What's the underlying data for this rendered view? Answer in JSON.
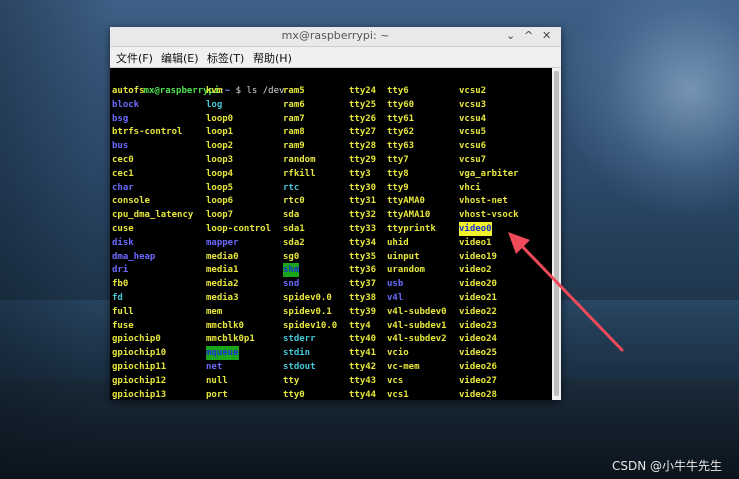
{
  "window": {
    "title": "mx@raspberrypi: ~",
    "minimize": "⌄",
    "maximize": "^",
    "close": "✕"
  },
  "menu": [
    {
      "label": "文件(F)"
    },
    {
      "label": "编辑(E)"
    },
    {
      "label": "标签(T)"
    },
    {
      "label": "帮助(H)"
    }
  ],
  "prompt": {
    "user": "mx@raspberrypi",
    "sep": ":",
    "path": "~",
    "cmd": " $ ls /dev"
  },
  "columns": [
    [
      {
        "t": "autofs",
        "c": "f"
      },
      {
        "t": "block",
        "c": "d"
      },
      {
        "t": "bsg",
        "c": "d"
      },
      {
        "t": "btrfs-control",
        "c": "f"
      },
      {
        "t": "bus",
        "c": "d"
      },
      {
        "t": "cec0",
        "c": "f"
      },
      {
        "t": "cec1",
        "c": "f"
      },
      {
        "t": "char",
        "c": "d"
      },
      {
        "t": "console",
        "c": "f"
      },
      {
        "t": "cpu_dma_latency",
        "c": "f"
      },
      {
        "t": "cuse",
        "c": "f"
      },
      {
        "t": "disk",
        "c": "d"
      },
      {
        "t": "dma_heap",
        "c": "d"
      },
      {
        "t": "dri",
        "c": "d"
      },
      {
        "t": "fb0",
        "c": "f"
      },
      {
        "t": "fd",
        "c": "l"
      },
      {
        "t": "full",
        "c": "f"
      },
      {
        "t": "fuse",
        "c": "f"
      },
      {
        "t": "gpiochip0",
        "c": "f"
      },
      {
        "t": "gpiochip10",
        "c": "f"
      },
      {
        "t": "gpiochip11",
        "c": "f"
      },
      {
        "t": "gpiochip12",
        "c": "f"
      },
      {
        "t": "gpiochip13",
        "c": "f"
      }
    ],
    [
      {
        "t": "kvm",
        "c": "f"
      },
      {
        "t": "log",
        "c": "l"
      },
      {
        "t": "loop0",
        "c": "f"
      },
      {
        "t": "loop1",
        "c": "f"
      },
      {
        "t": "loop2",
        "c": "f"
      },
      {
        "t": "loop3",
        "c": "f"
      },
      {
        "t": "loop4",
        "c": "f"
      },
      {
        "t": "loop5",
        "c": "f"
      },
      {
        "t": "loop6",
        "c": "f"
      },
      {
        "t": "loop7",
        "c": "f"
      },
      {
        "t": "loop-control",
        "c": "f"
      },
      {
        "t": "mapper",
        "c": "d"
      },
      {
        "t": "media0",
        "c": "f"
      },
      {
        "t": "media1",
        "c": "f"
      },
      {
        "t": "media2",
        "c": "f"
      },
      {
        "t": "media3",
        "c": "f"
      },
      {
        "t": "mem",
        "c": "f"
      },
      {
        "t": "mmcblk0",
        "c": "f"
      },
      {
        "t": "mmcblk0p1",
        "c": "f"
      },
      {
        "t": "mqueue",
        "c": "hl-green"
      },
      {
        "t": "net",
        "c": "d"
      },
      {
        "t": "null",
        "c": "f"
      },
      {
        "t": "port",
        "c": "f"
      }
    ],
    [
      {
        "t": "ram5",
        "c": "f"
      },
      {
        "t": "ram6",
        "c": "f"
      },
      {
        "t": "ram7",
        "c": "f"
      },
      {
        "t": "ram8",
        "c": "f"
      },
      {
        "t": "ram9",
        "c": "f"
      },
      {
        "t": "random",
        "c": "f"
      },
      {
        "t": "rfkill",
        "c": "f"
      },
      {
        "t": "rtc",
        "c": "l"
      },
      {
        "t": "rtc0",
        "c": "f"
      },
      {
        "t": "sda",
        "c": "f"
      },
      {
        "t": "sda1",
        "c": "f"
      },
      {
        "t": "sda2",
        "c": "f"
      },
      {
        "t": "sg0",
        "c": "f"
      },
      {
        "t": "shm",
        "c": "hl-green"
      },
      {
        "t": "snd",
        "c": "d"
      },
      {
        "t": "spidev0.0",
        "c": "f"
      },
      {
        "t": "spidev0.1",
        "c": "f"
      },
      {
        "t": "spidev10.0",
        "c": "f"
      },
      {
        "t": "stderr",
        "c": "l"
      },
      {
        "t": "stdin",
        "c": "l"
      },
      {
        "t": "stdout",
        "c": "l"
      },
      {
        "t": "tty",
        "c": "f"
      },
      {
        "t": "tty0",
        "c": "f"
      }
    ],
    [
      {
        "t": "tty24",
        "c": "f"
      },
      {
        "t": "tty25",
        "c": "f"
      },
      {
        "t": "tty26",
        "c": "f"
      },
      {
        "t": "tty27",
        "c": "f"
      },
      {
        "t": "tty28",
        "c": "f"
      },
      {
        "t": "tty29",
        "c": "f"
      },
      {
        "t": "tty3",
        "c": "f"
      },
      {
        "t": "tty30",
        "c": "f"
      },
      {
        "t": "tty31",
        "c": "f"
      },
      {
        "t": "tty32",
        "c": "f"
      },
      {
        "t": "tty33",
        "c": "f"
      },
      {
        "t": "tty34",
        "c": "f"
      },
      {
        "t": "tty35",
        "c": "f"
      },
      {
        "t": "tty36",
        "c": "f"
      },
      {
        "t": "tty37",
        "c": "f"
      },
      {
        "t": "tty38",
        "c": "f"
      },
      {
        "t": "tty39",
        "c": "f"
      },
      {
        "t": "tty4",
        "c": "f"
      },
      {
        "t": "tty40",
        "c": "f"
      },
      {
        "t": "tty41",
        "c": "f"
      },
      {
        "t": "tty42",
        "c": "f"
      },
      {
        "t": "tty43",
        "c": "f"
      },
      {
        "t": "tty44",
        "c": "f"
      }
    ],
    [
      {
        "t": "tty6",
        "c": "f"
      },
      {
        "t": "tty60",
        "c": "f"
      },
      {
        "t": "tty61",
        "c": "f"
      },
      {
        "t": "tty62",
        "c": "f"
      },
      {
        "t": "tty63",
        "c": "f"
      },
      {
        "t": "tty7",
        "c": "f"
      },
      {
        "t": "tty8",
        "c": "f"
      },
      {
        "t": "tty9",
        "c": "f"
      },
      {
        "t": "ttyAMA0",
        "c": "f"
      },
      {
        "t": "ttyAMA10",
        "c": "f"
      },
      {
        "t": "ttyprintk",
        "c": "f"
      },
      {
        "t": "uhid",
        "c": "f"
      },
      {
        "t": "uinput",
        "c": "f"
      },
      {
        "t": "urandom",
        "c": "f"
      },
      {
        "t": "usb",
        "c": "d"
      },
      {
        "t": "v4l",
        "c": "d"
      },
      {
        "t": "v4l-subdev0",
        "c": "f"
      },
      {
        "t": "v4l-subdev1",
        "c": "f"
      },
      {
        "t": "v4l-subdev2",
        "c": "f"
      },
      {
        "t": "vcio",
        "c": "f"
      },
      {
        "t": "vc-mem",
        "c": "f"
      },
      {
        "t": "vcs",
        "c": "f"
      },
      {
        "t": "vcs1",
        "c": "f"
      }
    ],
    [
      {
        "t": "vcsu2",
        "c": "f"
      },
      {
        "t": "vcsu3",
        "c": "f"
      },
      {
        "t": "vcsu4",
        "c": "f"
      },
      {
        "t": "vcsu5",
        "c": "f"
      },
      {
        "t": "vcsu6",
        "c": "f"
      },
      {
        "t": "vcsu7",
        "c": "f"
      },
      {
        "t": "vga_arbiter",
        "c": "f"
      },
      {
        "t": "vhci",
        "c": "f"
      },
      {
        "t": "vhost-net",
        "c": "f"
      },
      {
        "t": "vhost-vsock",
        "c": "f"
      },
      {
        "t": "video0",
        "c": "hl-yellow"
      },
      {
        "t": "video1",
        "c": "f"
      },
      {
        "t": "video19",
        "c": "f"
      },
      {
        "t": "video2",
        "c": "f"
      },
      {
        "t": "video20",
        "c": "f"
      },
      {
        "t": "video21",
        "c": "f"
      },
      {
        "t": "video22",
        "c": "f"
      },
      {
        "t": "video23",
        "c": "f"
      },
      {
        "t": "video24",
        "c": "f"
      },
      {
        "t": "video25",
        "c": "f"
      },
      {
        "t": "video26",
        "c": "f"
      },
      {
        "t": "video27",
        "c": "f"
      },
      {
        "t": "video28",
        "c": "f"
      }
    ]
  ],
  "colors": {
    "file": "#e6e63c",
    "dir": "#6a6aff",
    "link": "#44c8d8",
    "prompt_user": "#4ee24e"
  },
  "watermark": "CSDN @小牛牛先生"
}
